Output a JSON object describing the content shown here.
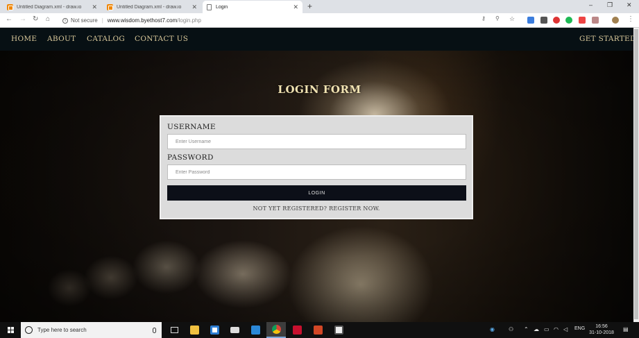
{
  "browser": {
    "tabs": [
      {
        "title": "Untitled Diagram.xml - draw.io",
        "active": false
      },
      {
        "title": "Untitled Diagram.xml - draw.io",
        "active": false
      },
      {
        "title": "Login",
        "active": true
      }
    ],
    "new_tab_symbol": "+",
    "window_controls": {
      "minimize": "–",
      "restore": "❐",
      "close": "✕"
    },
    "address": {
      "security_label": "Not secure",
      "domain": "www.wisdom.byethost7.com",
      "path": "/login.php"
    },
    "nav_icons": [
      "back-icon",
      "forward-icon",
      "reload-icon",
      "home-icon"
    ]
  },
  "site_nav": {
    "links": [
      "HOME",
      "ABOUT",
      "CATALOG",
      "CONTACT US"
    ],
    "get_started": "GET STARTED"
  },
  "login": {
    "title": "LOGIN FORM",
    "username_label": "USERNAME",
    "username_placeholder": "Enter Username",
    "password_label": "PASSWORD",
    "password_placeholder": "Enter Password",
    "submit_label": "LOGIN",
    "register_text": "NOT YET REGISTERED? REGISTER NOW."
  },
  "taskbar": {
    "search_placeholder": "Type here to search",
    "language": "ENG",
    "time": "16:56",
    "date": "31-10-2018"
  },
  "colors": {
    "nav_bg": "#071014",
    "nav_text": "#d9c89a",
    "card_bg": "#dcdcdc",
    "button_bg": "#0c0f18",
    "title_text": "#f1e3b2"
  }
}
